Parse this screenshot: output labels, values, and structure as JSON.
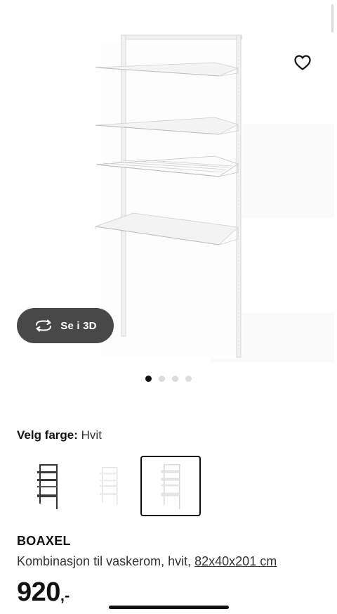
{
  "gallery": {
    "image_count": 4,
    "active_index": 0,
    "view_3d_label": "Se i 3D"
  },
  "color": {
    "label": "Velg farge:",
    "value": "Hvit",
    "swatches": [
      {
        "name": "Antrasitt",
        "selected": false
      },
      {
        "name": "Hvit",
        "selected": false
      },
      {
        "name": "Hvit",
        "selected": true
      }
    ]
  },
  "product": {
    "brand": "BOAXEL",
    "description": "Kombinasjon til vaskerom, hvit,",
    "measure": "82x40x201 cm",
    "price": "920",
    "price_suffix": ",-"
  },
  "colors": {
    "text": "#111111",
    "button_3d": "#484848",
    "dot_inactive": "#dcdcdc"
  }
}
